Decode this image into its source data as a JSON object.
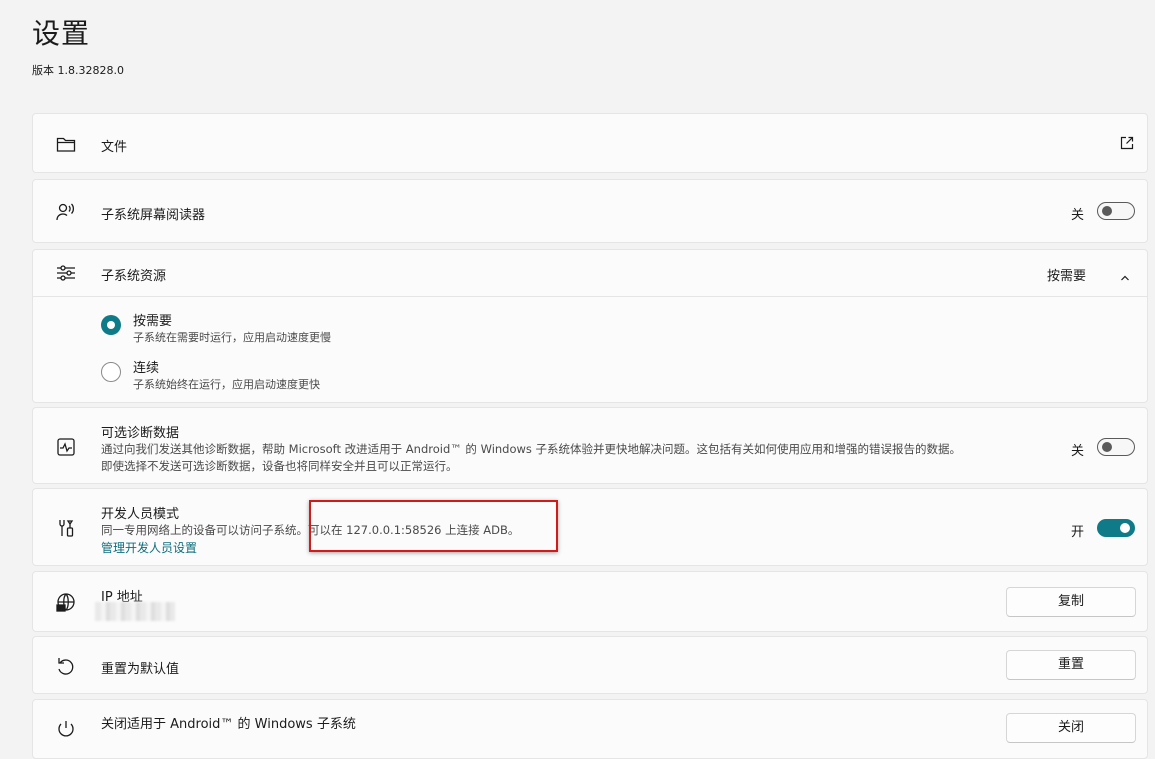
{
  "header": {
    "title": "设置",
    "version": "版本 1.8.32828.0"
  },
  "files": {
    "label": "文件"
  },
  "screen_reader": {
    "label": "子系统屏幕阅读器",
    "state_label": "关",
    "on": false
  },
  "resources": {
    "label": "子系统资源",
    "selected_value": "按需要",
    "options": [
      {
        "label": "按需要",
        "desc": "子系统在需要时运行，应用启动速度更慢",
        "checked": true
      },
      {
        "label": "连续",
        "desc": "子系统始终在运行，应用启动速度更快",
        "checked": false
      }
    ]
  },
  "diagnostics": {
    "label": "可选诊断数据",
    "desc_line1": "通过向我们发送其他诊断数据，帮助 Microsoft 改进适用于 Android™ 的 Windows 子系统体验并更快地解决问题。这包括有关如何使用应用和增强的错误报告的数据。",
    "desc_line2": "即使选择不发送可选诊断数据，设备也将同样安全并且可以正常运行。",
    "state_label": "关",
    "on": false
  },
  "developer": {
    "label": "开发人员模式",
    "desc": "同一专用网络上的设备可以访问子系统。可以在 127.0.0.1:58526 上连接 ADB。",
    "link": "管理开发人员设置",
    "state_label": "开",
    "on": true
  },
  "ip": {
    "label": "IP 地址",
    "button": "复制"
  },
  "reset": {
    "label": "重置为默认值",
    "button": "重置"
  },
  "shutdown": {
    "label": "关闭适用于 Android™ 的 Windows 子系统",
    "button": "关闭"
  },
  "colors": {
    "accent": "#0f7a88",
    "link": "#0f6e7d",
    "highlight": "#d11a1a"
  }
}
